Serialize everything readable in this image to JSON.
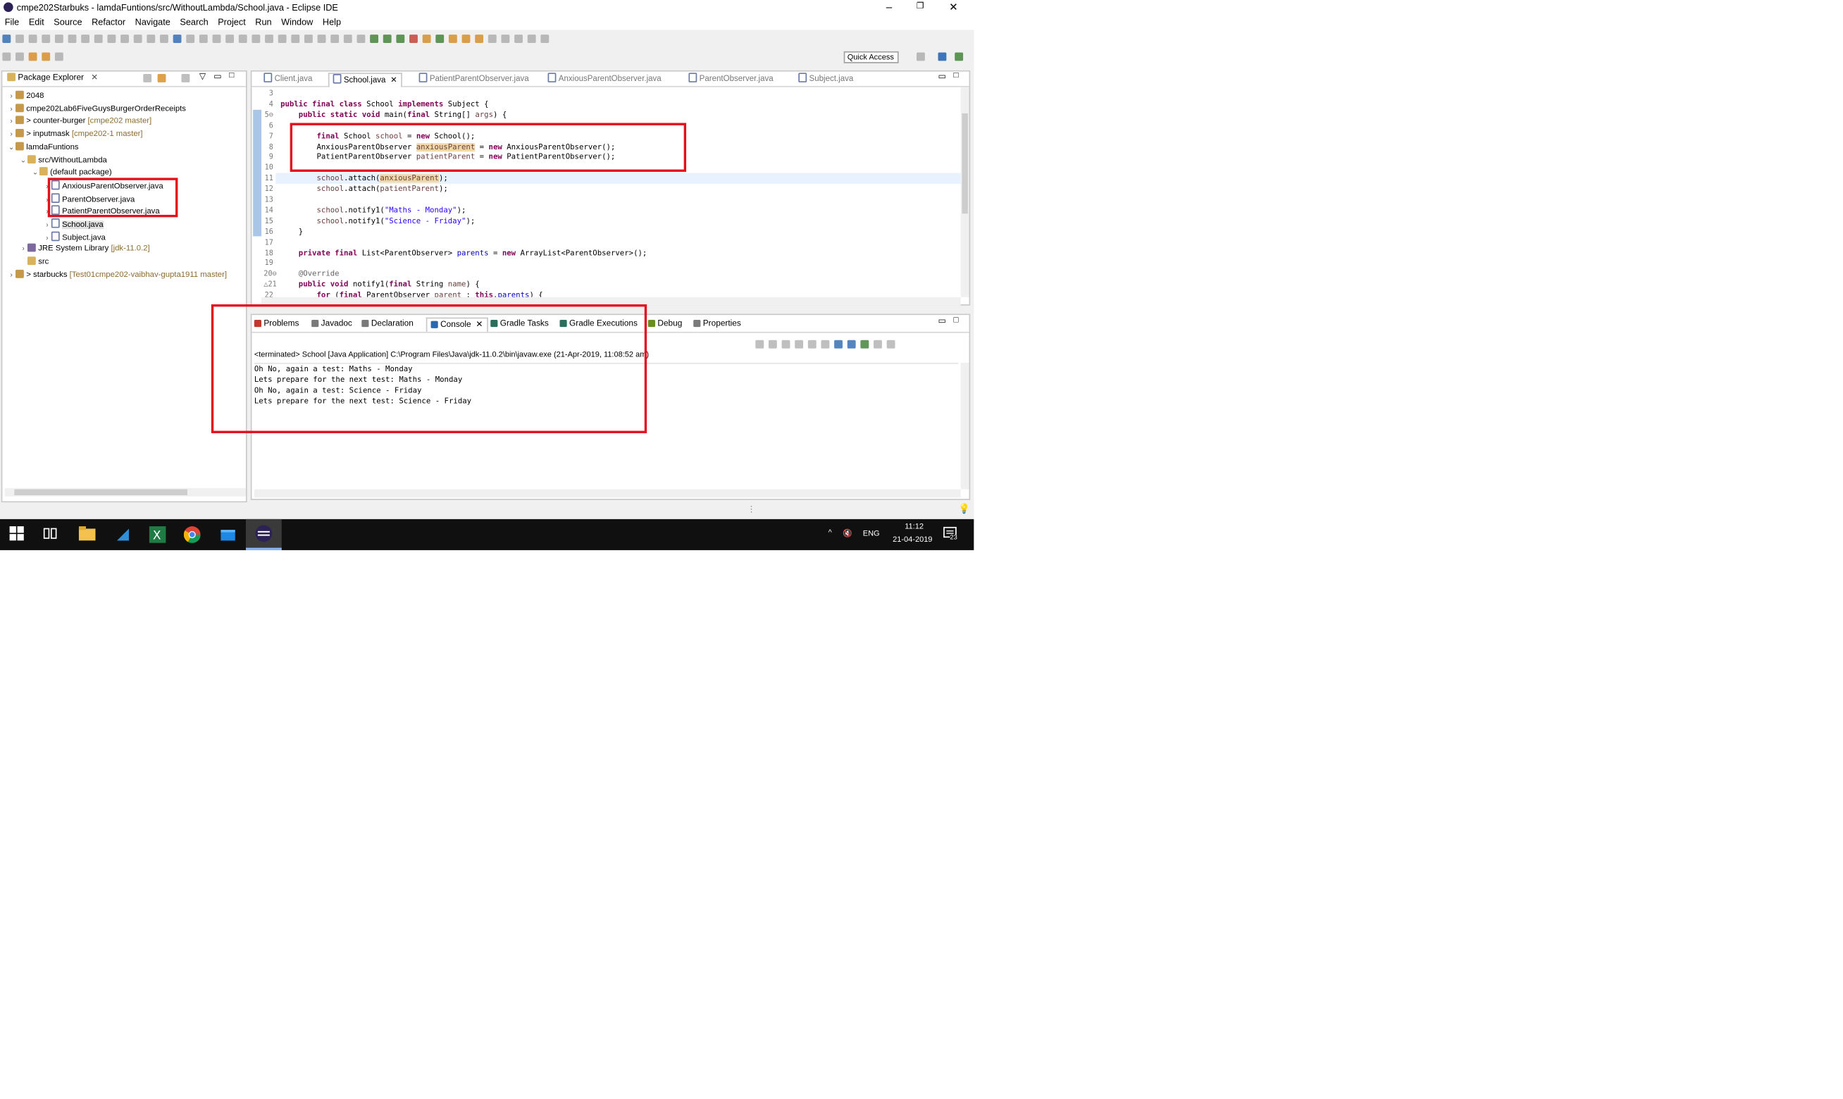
{
  "window": {
    "title": "cmpe202Starbuks - lamdaFuntions/src/WithoutLambda/School.java - Eclipse IDE",
    "min": "–",
    "max": "❐",
    "close": "✕"
  },
  "menu": [
    "File",
    "Edit",
    "Source",
    "Refactor",
    "Navigate",
    "Search",
    "Project",
    "Run",
    "Window",
    "Help"
  ],
  "toolbar": {
    "quick_access": "Quick Access"
  },
  "package_explorer": {
    "tab_label": "Package Explorer",
    "close": "✕",
    "rows": [
      {
        "twisty": "›",
        "text": "2048",
        "decoration": ""
      },
      {
        "twisty": "›",
        "text": "cmpe202Lab6FiveGuysBurgerOrderReceipts",
        "decoration": ""
      },
      {
        "twisty": "›",
        "text": "> counter-burger",
        "decoration": " [cmpe202 master]"
      },
      {
        "twisty": "›",
        "text": "> inputmask",
        "decoration": " [cmpe202-1 master]"
      },
      {
        "twisty": "⌄",
        "text": "lamdaFuntions",
        "decoration": ""
      },
      {
        "twisty": "⌄",
        "text": "src/WithoutLambda",
        "decoration": ""
      },
      {
        "twisty": "⌄",
        "text": "(default package)",
        "decoration": ""
      },
      {
        "twisty": "›",
        "text": "AnxiousParentObserver.java",
        "decoration": ""
      },
      {
        "twisty": "›",
        "text": "ParentObserver.java",
        "decoration": ""
      },
      {
        "twisty": "›",
        "text": "PatientParentObserver.java",
        "decoration": ""
      },
      {
        "twisty": "›",
        "text": "School.java",
        "decoration": ""
      },
      {
        "twisty": "›",
        "text": "Subject.java",
        "decoration": ""
      },
      {
        "twisty": "›",
        "text": "JRE System Library",
        "decoration": " [jdk-11.0.2]"
      },
      {
        "twisty": "",
        "text": "src",
        "decoration": ""
      },
      {
        "twisty": "›",
        "text": "> starbucks",
        "decoration": " [Test01cmpe202-vaibhav-gupta1911 master]"
      }
    ]
  },
  "editor": {
    "tabs": [
      "Client.java",
      "School.java",
      "PatientParentObserver.java",
      "AnxiousParentObserver.java",
      "ParentObserver.java",
      "Subject.java"
    ],
    "active_tab": "School.java",
    "close": "✕",
    "lines": [
      {
        "n": "3",
        "html": ""
      },
      {
        "n": "4",
        "html": "<span class='kw'>public final class</span> School <span class='kw'>implements</span> Subject {"
      },
      {
        "n": "5⊖",
        "html": "    <span class='kw'>public static void</span> main(<span class='kw'>final</span> String[] <span class='loc'>args</span>) {"
      },
      {
        "n": "6",
        "html": ""
      },
      {
        "n": "7",
        "html": "        <span class='kw'>final</span> School <span class='loc'>school</span> = <span class='kw'>new</span> School();"
      },
      {
        "n": "8",
        "html": "        AnxiousParentObserver <span class='loc hl'>anxiousParent</span> = <span class='kw'>new</span> AnxiousParentObserver();"
      },
      {
        "n": "9",
        "html": "        PatientParentObserver <span class='loc'>patientParent</span> = <span class='kw'>new</span> PatientParentObserver();"
      },
      {
        "n": "10",
        "html": ""
      },
      {
        "n": "11",
        "html": "        <span class='loc'>school</span>.attach(<span class='loc hl'>anxiousParent</span>);"
      },
      {
        "n": "12",
        "html": "        <span class='loc'>school</span>.attach(<span class='loc'>patientParent</span>);"
      },
      {
        "n": "13",
        "html": ""
      },
      {
        "n": "14",
        "html": "        <span class='loc'>school</span>.notify1(<span class='str'>\"Maths - Monday\"</span>);"
      },
      {
        "n": "15",
        "html": "        <span class='loc'>school</span>.notify1(<span class='str'>\"Science - Friday\"</span>);"
      },
      {
        "n": "16",
        "html": "    }"
      },
      {
        "n": "17",
        "html": ""
      },
      {
        "n": "18",
        "html": "    <span class='kw'>private final</span> List&lt;ParentObserver&gt; <span class='fld'>parents</span> = <span class='kw'>new</span> ArrayList&lt;ParentObserver&gt;();"
      },
      {
        "n": "19",
        "html": ""
      },
      {
        "n": "20⊖",
        "html": "    <span class='ann'>@Override</span>"
      },
      {
        "n": "△21",
        "html": "    <span class='kw'>public void</span> notify1(<span class='kw'>final</span> String <span class='loc'>name</span>) {"
      },
      {
        "n": "22",
        "html": "        <span class='kw'>for</span> (<span class='kw'>final</span> ParentObserver <span class='loc'>parent</span> : <span class='kw'>this</span>.<span class='fld'>parents</span>) {"
      }
    ]
  },
  "bottom_panel": {
    "tabs": [
      {
        "label": "Problems",
        "color": "#c0392b"
      },
      {
        "label": "Javadoc",
        "color": "#7a7a7a"
      },
      {
        "label": "Declaration",
        "color": "#7a7a7a"
      },
      {
        "label": "Console",
        "color": "#2a67b1"
      },
      {
        "label": "Gradle Tasks",
        "color": "#2a6f5e"
      },
      {
        "label": "Gradle Executions",
        "color": "#2a6f5e"
      },
      {
        "label": "Debug",
        "color": "#6b8e23"
      },
      {
        "label": "Properties",
        "color": "#7a7a7a"
      }
    ],
    "active_tab": "Console",
    "close": "✕",
    "terminated": "<terminated> School [Java Application] C:\\Program Files\\Java\\jdk-11.0.2\\bin\\javaw.exe (21-Apr-2019, 11:08:52 am)",
    "output": [
      "Oh No, again a test: Maths - Monday",
      "Lets prepare for the next test: Maths - Monday",
      "Oh No, again a test: Science - Friday",
      "Lets prepare for the next test: Science - Friday"
    ]
  },
  "taskbar": {
    "lang": "ENG",
    "time": "11:12",
    "date": "21-04-2019",
    "notif_count": "23",
    "chevron": "^",
    "volume": "🔇"
  },
  "colors": {
    "highlight_box": "#e3101c",
    "keyword": "#7f0055",
    "string": "#2a00ff"
  }
}
